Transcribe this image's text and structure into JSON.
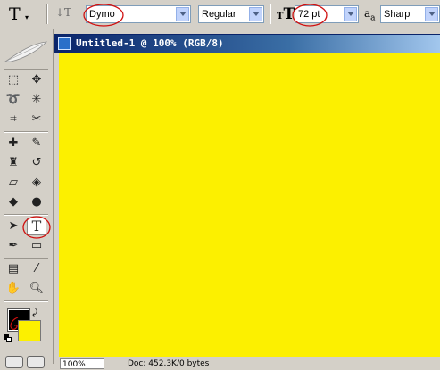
{
  "options_bar": {
    "font_family": "Dymo",
    "font_style": "Regular",
    "font_size": "72 pt",
    "antialias": "Sharp",
    "tool_icon": "type-tool-icon",
    "orientation_icon": "text-orientation-icon",
    "size_icon": "font-size-icon",
    "antialias_icon": "antialias-icon"
  },
  "document": {
    "title": "Untitled-1 @ 100% (RGB/8)",
    "canvas_color": "#fcf000",
    "zoom": "100%",
    "doc_info": "Doc: 452.3K/0 bytes"
  },
  "colors": {
    "foreground": "#000000",
    "background": "#fcf000",
    "annotation": "#d01010"
  },
  "toolbox": {
    "active_tool": "horizontal-type-tool"
  }
}
